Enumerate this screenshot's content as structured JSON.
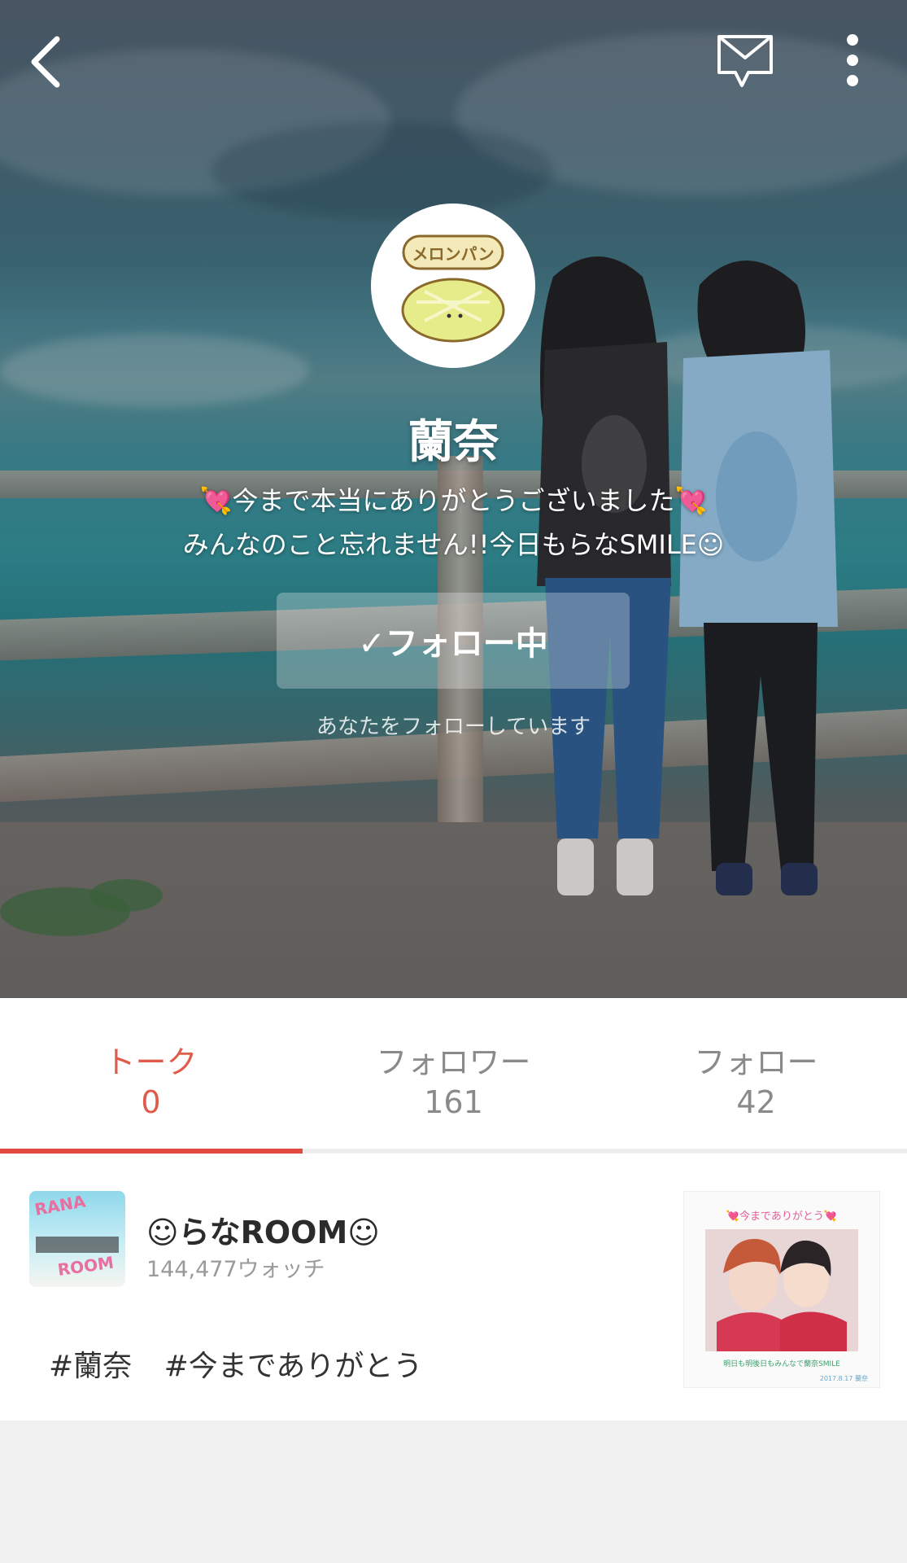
{
  "header": {
    "back_icon": "chevron-left-icon",
    "message_icon": "envelope-icon",
    "more_icon": "vertical-ellipsis-icon"
  },
  "profile": {
    "avatar_text": "メロンパン",
    "name": "蘭奈",
    "bio_line1": "💘今まで本当にありがとうございました💘",
    "bio_line2": "みんなのこと忘れません!!今日もらなSMILE☺",
    "follow_button_label": "✓フォロー中",
    "follow_note": "あなたをフォローしています"
  },
  "tabs": [
    {
      "label": "トーク",
      "count": "0",
      "active": true
    },
    {
      "label": "フォロワー",
      "count": "161",
      "active": false
    },
    {
      "label": "フォロー",
      "count": "42",
      "active": false
    }
  ],
  "post": {
    "room_thumb_text_top": "RANA",
    "room_thumb_text_bottom": "ROOM",
    "room_name": "☺らなROOM☺",
    "room_watch": "144,477ウォッチ",
    "hashtags": [
      "#蘭奈",
      "#今までありがとう"
    ],
    "thumb_caption": "💘今までありがとう💘",
    "thumb_footer": "明日も明後日もみんなで蘭奈SMILE",
    "thumb_date": "2017.8.17 蘭奈"
  },
  "colors": {
    "accent": "#e04a3f",
    "tab_inactive": "#8a8a8a",
    "background": "#f1f1f1"
  }
}
